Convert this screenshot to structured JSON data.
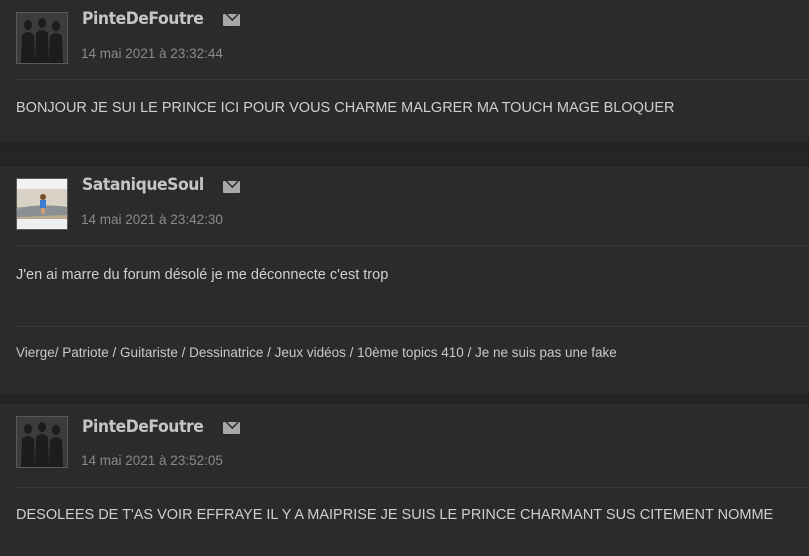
{
  "posts": [
    {
      "username": "PinteDeFoutre",
      "date": "14 mai 2021 à 23:32:44",
      "message": "BONJOUR JE SUI LE PRINCE ICI POUR VOUS CHARME MALGRER MA TOUCH MAGE BLOQUER",
      "avatar": "silhouettes"
    },
    {
      "username": "SataniqueSoul",
      "date": "14 mai 2021 à 23:42:30",
      "message": "J'en ai marre du forum désolé je me déconnecte c'est trop",
      "signature": "Vierge/ Patriote / Guitariste / Dessinatrice / Jeux vidéos / 10ème topics 410 / Je ne suis pas une fake",
      "avatar": "beach-photo"
    },
    {
      "username": "PinteDeFoutre",
      "date": "14 mai 2021 à 23:52:05",
      "message": "DESOLEES DE T'AS VOIR EFFRAYE IL Y A MAIPRISE JE SUIS LE PRINCE CHARMANT SUS CITEMENT NOMME",
      "avatar": "silhouettes"
    }
  ],
  "icons": {
    "mail": "envelope-icon"
  }
}
